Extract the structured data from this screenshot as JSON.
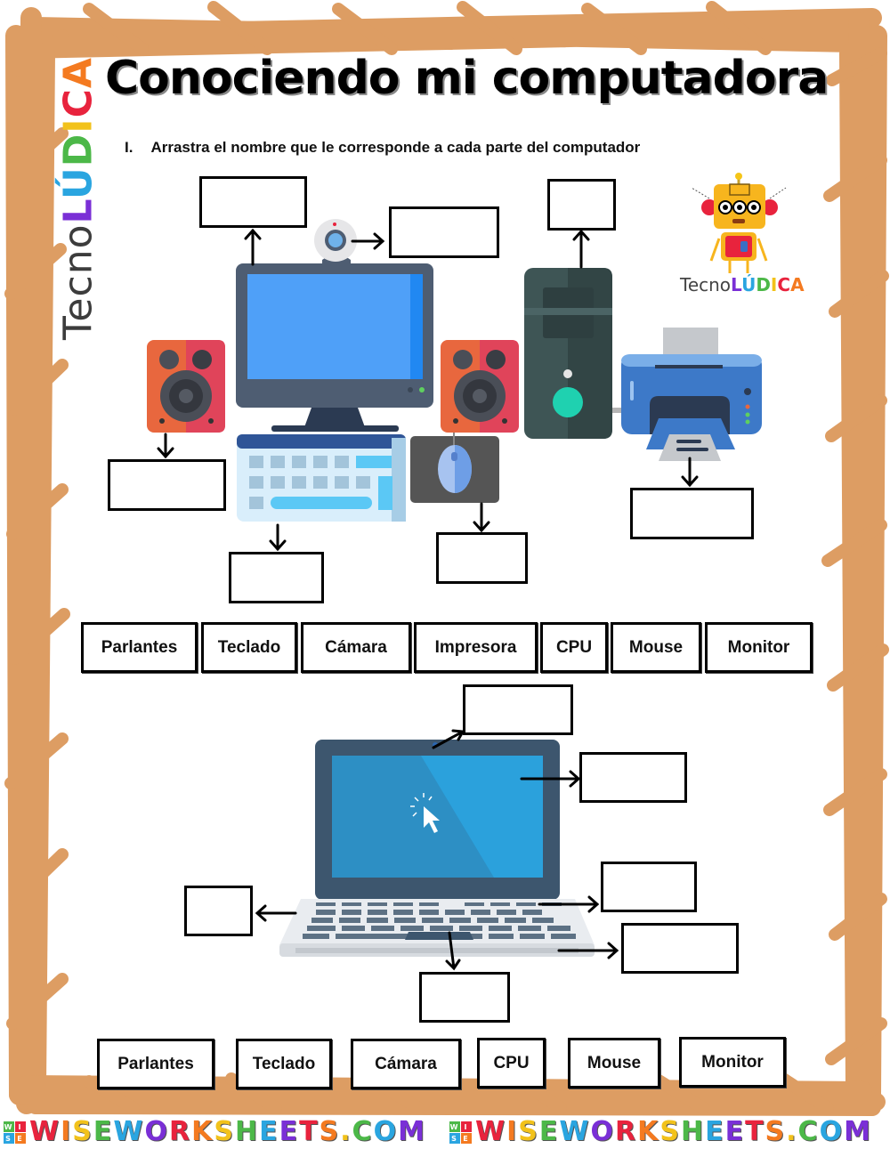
{
  "header": {
    "title": "Conociendo mi computadora",
    "instruction_number": "I.",
    "instruction": "Arrastra el nombre que le corresponde a cada parte del computador"
  },
  "branding": {
    "side_logo_part1": "Tecno",
    "side_logo_letters": [
      "L",
      "Ú",
      "D",
      "I",
      "C",
      "A"
    ],
    "side_logo_colors": [
      "#7a2fd6",
      "#2aa5e0",
      "#4cb848",
      "#f2c21b",
      "#e8233d",
      "#f47a20"
    ],
    "robot_logo_part1": "Tecno",
    "robot_logo_letters": [
      "L",
      "Ú",
      "D",
      "I",
      "C",
      "A"
    ]
  },
  "section1": {
    "label_bank": [
      "Parlantes",
      "Teclado",
      "Cámara",
      "Impresora",
      "CPU",
      "Mouse",
      "Monitor"
    ],
    "drop_targets": [
      "monitor",
      "camera",
      "cpu",
      "speaker",
      "keyboard",
      "mouse",
      "printer"
    ]
  },
  "section2": {
    "label_bank": [
      "Parlantes",
      "Teclado",
      "Cámara",
      "CPU",
      "Mouse",
      "Monitor"
    ],
    "drop_targets": [
      "camera",
      "screen",
      "keyboard-left",
      "keyboard-right",
      "touchpad",
      "body-right"
    ]
  },
  "footer": {
    "watermark": "WISEWORKSHEETS.COM",
    "watermark_letters_colors": [
      "#e8233d",
      "#f47a20",
      "#f2c21b",
      "#4cb848",
      "#2aa5e0",
      "#7a2fd6"
    ],
    "badge_letters": [
      "W",
      "I",
      "S",
      "E"
    ]
  },
  "colors": {
    "border": "#dd9d63",
    "monitor_frame": "#4e5d72",
    "monitor_screen": "#4fa0f8",
    "laptop_screen": "#2d8fc4"
  }
}
